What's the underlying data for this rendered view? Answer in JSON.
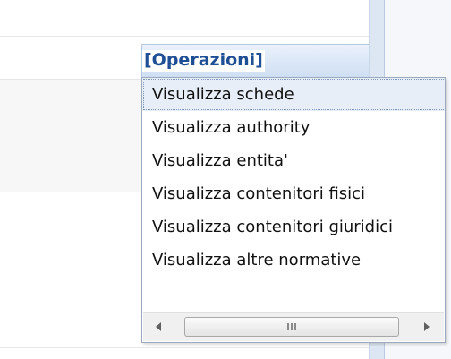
{
  "header": {
    "operations_label": "[Operazioni]"
  },
  "menu": {
    "items": [
      {
        "label": "Visualizza schede"
      },
      {
        "label": "Visualizza authority"
      },
      {
        "label": "Visualizza entita'"
      },
      {
        "label": "Visualizza contenitori fisici"
      },
      {
        "label": "Visualizza contenitori giuridici"
      },
      {
        "label": "Visualizza altre normative"
      }
    ],
    "selected_index": 0
  },
  "scrollbar": {
    "orientation": "horizontal",
    "icons": [
      "left-arrow-icon",
      "grip-icon",
      "right-arrow-icon"
    ]
  },
  "colors": {
    "accent": "#1e4e94",
    "header_gradient_top": "#eaf1fb",
    "header_gradient_bottom": "#cfdff3",
    "selected_bg": "#e7eef8"
  }
}
